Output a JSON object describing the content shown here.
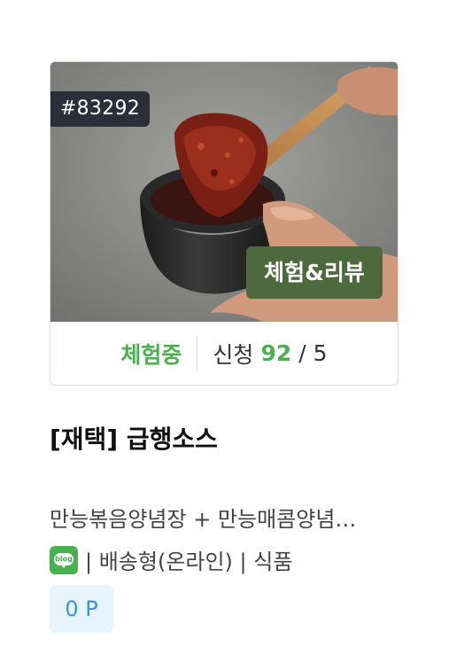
{
  "card": {
    "id_badge": "#83292",
    "type_badge": "체험&리뷰",
    "status": "체험중",
    "apply_label": "신청",
    "apply_count": "92",
    "apply_slash": "/",
    "apply_limit": "5",
    "title": "[재택] 급행소스",
    "description": "만능볶음양념장 + 만능매콤양념…",
    "platform_icon": "blog-icon",
    "platform_icon_text": "blog",
    "meta": "| 배송형(온라인) | 식품",
    "points": "0 P"
  },
  "colors": {
    "accent_green": "#4caf50",
    "type_badge_bg": "#4d6a3f",
    "id_badge_bg": "#2c2f3a",
    "points_bg": "#e8f4fd",
    "points_text": "#3a93d8"
  }
}
